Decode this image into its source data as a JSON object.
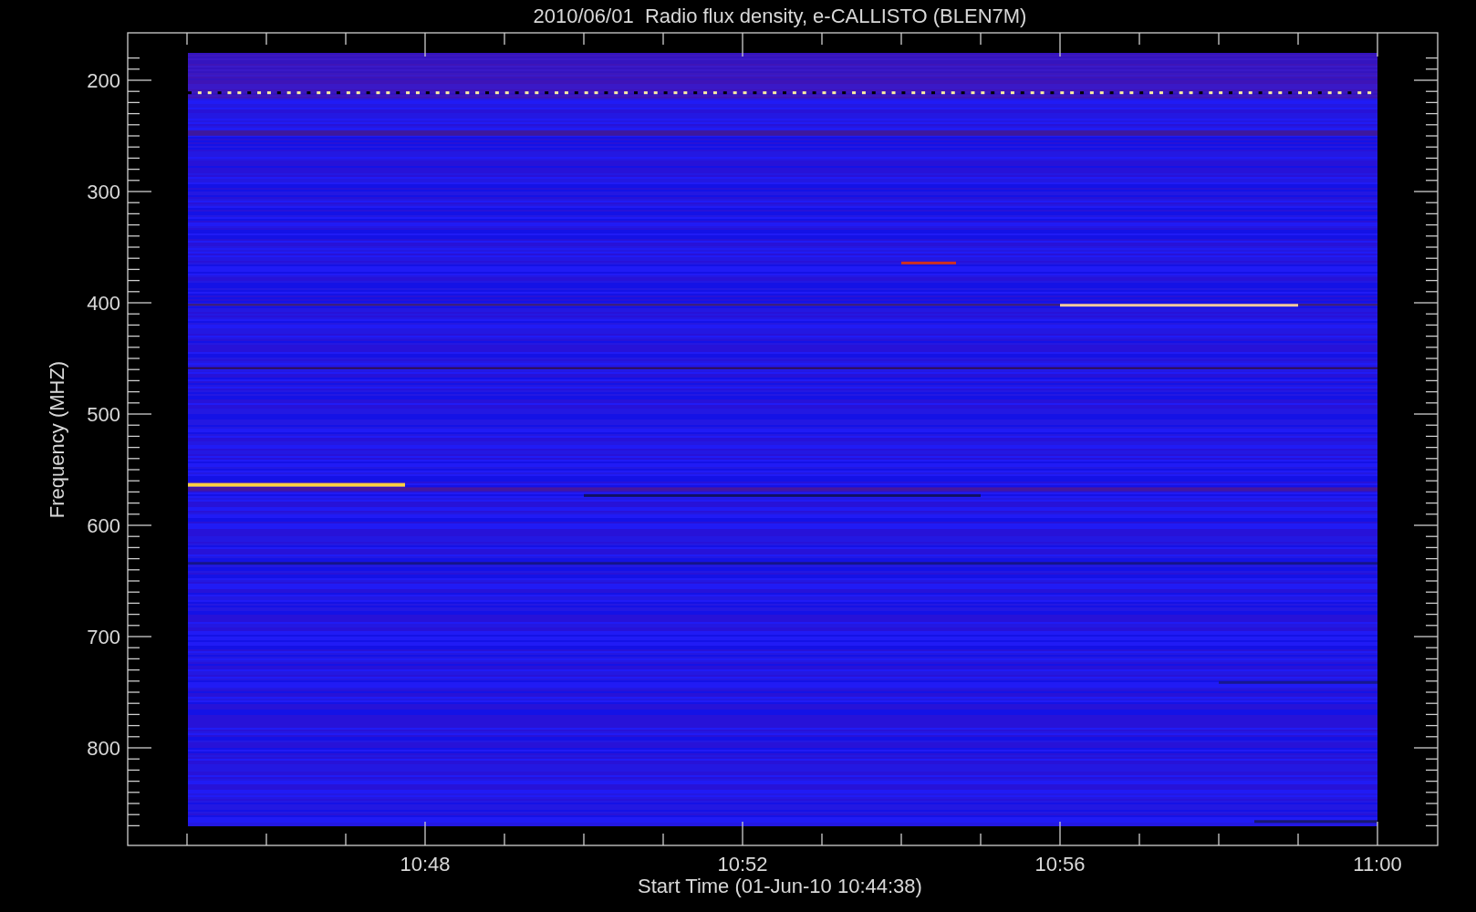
{
  "title": "2010/06/01  Radio flux density, e-CALLISTO (BLEN7M)",
  "y_axis": {
    "label": "Frequency (MHZ)",
    "ticks": [
      "200",
      "300",
      "400",
      "500",
      "600",
      "700",
      "800"
    ]
  },
  "x_axis": {
    "label": "Start Time (01-Jun-10 10:44:38)",
    "ticks": [
      "10:48",
      "10:52",
      "10:56",
      "11:00"
    ]
  }
}
